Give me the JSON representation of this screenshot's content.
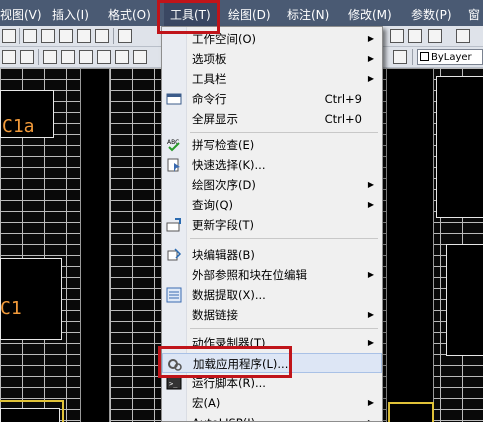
{
  "menubar": {
    "items": [
      {
        "label": "视图(V)"
      },
      {
        "label": "插入(I)"
      },
      {
        "label": "格式(O)"
      },
      {
        "label": "工具(T)"
      },
      {
        "label": "绘图(D)"
      },
      {
        "label": "标注(N)"
      },
      {
        "label": "修改(M)"
      },
      {
        "label": "参数(P)"
      },
      {
        "label": "窗"
      }
    ]
  },
  "toolbar": {
    "layer_combo_value": "ByLayer"
  },
  "drawing": {
    "label_top": "C1a",
    "label_mid": "C1"
  },
  "tools_menu": {
    "items": [
      {
        "label": "工作空间(O)",
        "submenu": true
      },
      {
        "label": "选项板",
        "submenu": true
      },
      {
        "label": "工具栏",
        "submenu": true
      },
      {
        "label": "命令行",
        "shortcut": "Ctrl+9",
        "icon": "command-line-icon"
      },
      {
        "label": "全屏显示",
        "shortcut": "Ctrl+0"
      },
      {
        "label": "拼写检查(E)",
        "icon": "spell-check-icon"
      },
      {
        "label": "快速选择(K)...",
        "icon": "quick-select-icon"
      },
      {
        "label": "绘图次序(D)",
        "submenu": true
      },
      {
        "label": "查询(Q)",
        "submenu": true
      },
      {
        "label": "更新字段(T)",
        "icon": "update-field-icon"
      },
      {
        "label": "块编辑器(B)",
        "icon": "block-editor-icon"
      },
      {
        "label": "外部参照和块在位编辑",
        "submenu": true
      },
      {
        "label": "数据提取(X)...",
        "icon": "data-extraction-icon"
      },
      {
        "label": "数据链接",
        "submenu": true
      },
      {
        "label": "动作录制器(T)",
        "submenu": true
      },
      {
        "label": "加载应用程序(L)...",
        "icon": "load-application-icon"
      },
      {
        "label": "运行脚本(R)...",
        "icon": "run-script-icon"
      },
      {
        "label": "宏(A)",
        "submenu": true
      },
      {
        "label": "AutoLISP(I)",
        "submenu": true
      }
    ]
  },
  "colors": {
    "menubar_bg": "#4a5a73",
    "highlight_red": "#c0141a",
    "cad_label": "#f29a3a",
    "selected_item_bg": "#dde6f5"
  }
}
